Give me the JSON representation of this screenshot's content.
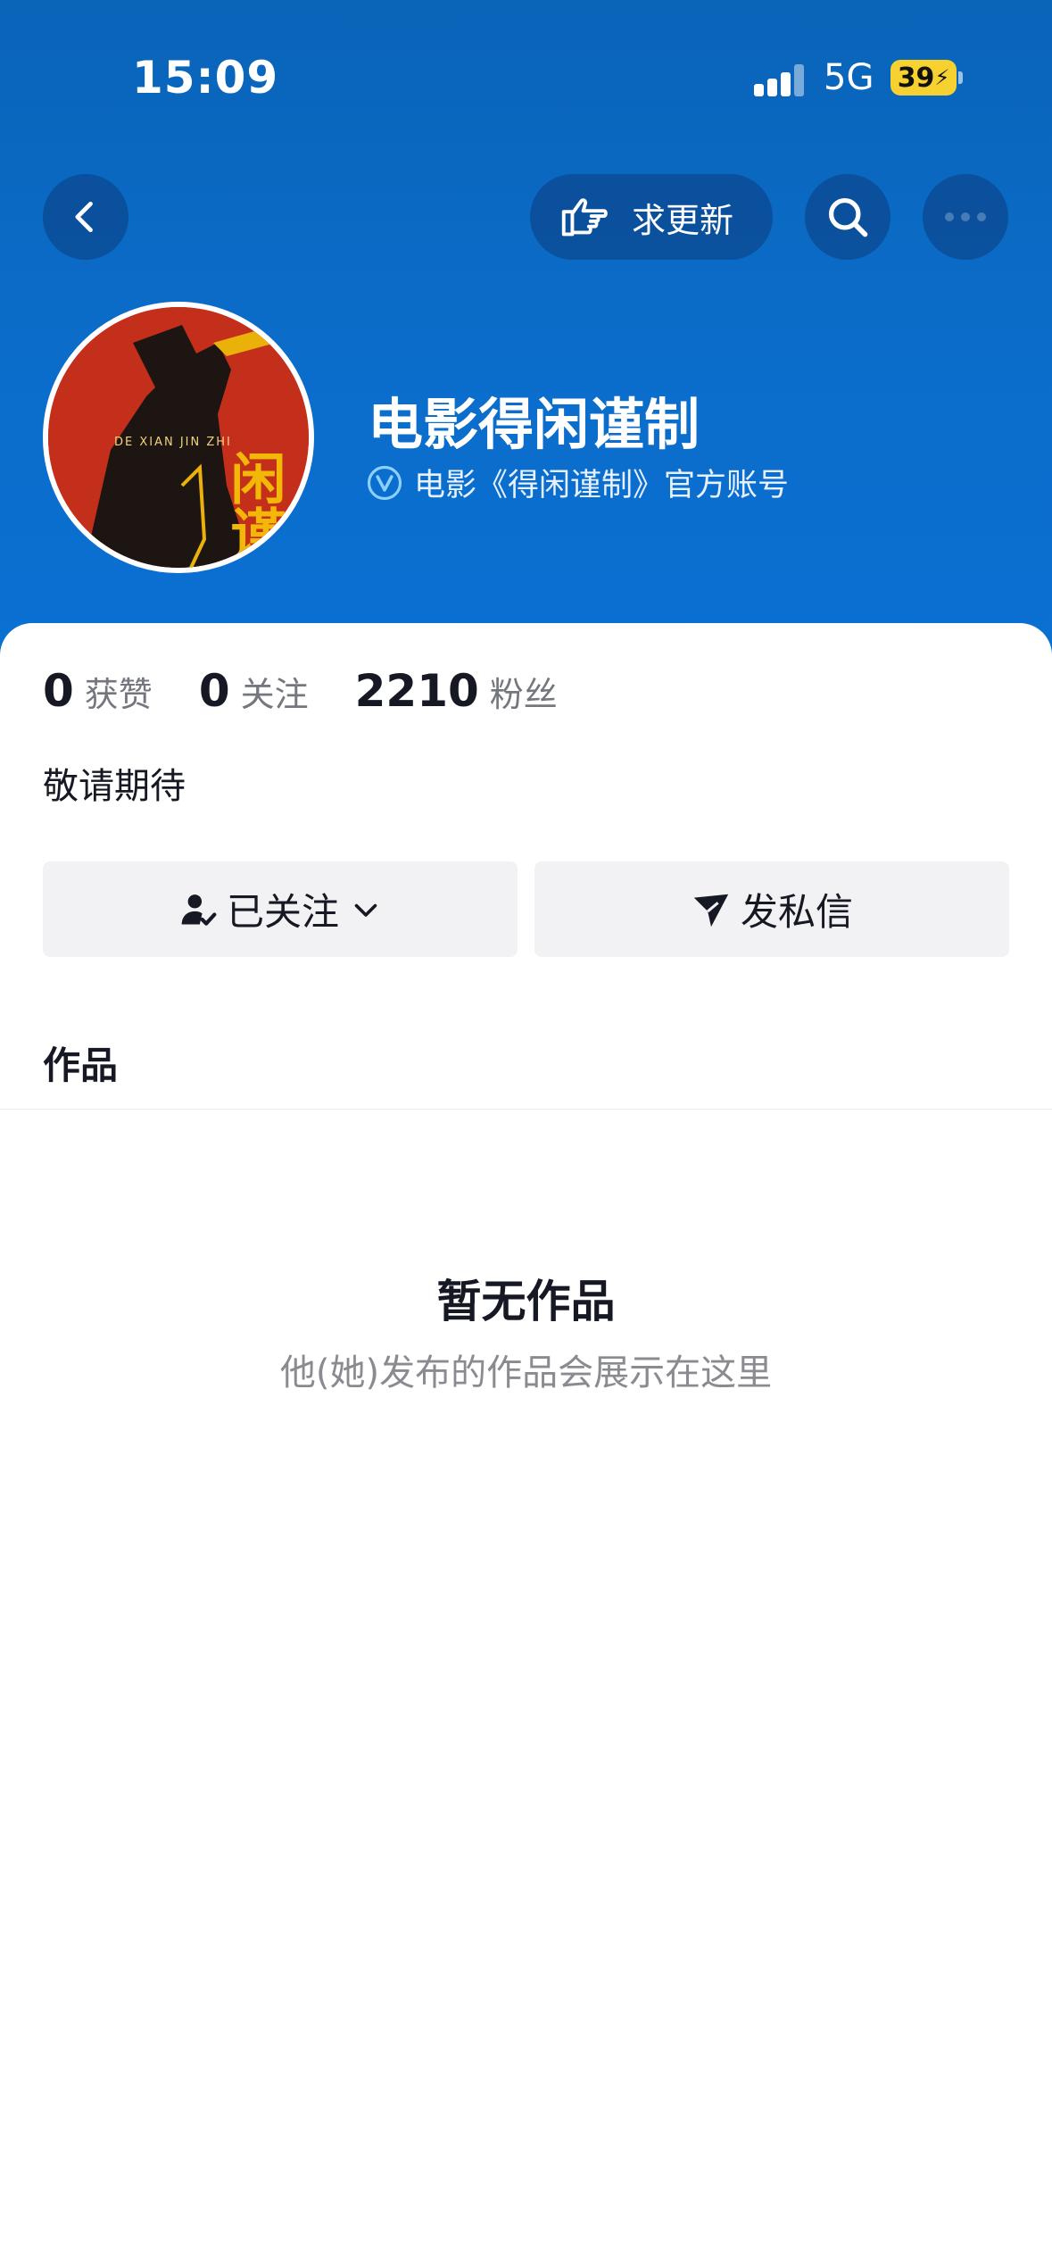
{
  "status_bar": {
    "time": "15:09",
    "network": "5G",
    "battery": "39"
  },
  "nav": {
    "request_update_label": "求更新"
  },
  "profile": {
    "name": "电影得闲谨制",
    "verified_text": "电影《得闲谨制》官方账号",
    "avatar_art_text": "闲谨",
    "avatar_subtext": "DE XIAN JIN ZHI"
  },
  "stats": [
    {
      "value": "0",
      "label": "获赞"
    },
    {
      "value": "0",
      "label": "关注"
    },
    {
      "value": "2210",
      "label": "粉丝"
    }
  ],
  "bio": "敬请期待",
  "actions": {
    "follow_label": "已关注",
    "message_label": "发私信"
  },
  "tabs": {
    "works_label": "作品"
  },
  "empty_state": {
    "title": "暂无作品",
    "subtitle": "他(她)发布的作品会展示在这里"
  },
  "colors": {
    "header_blue": "#0b6dcb",
    "battery_yellow": "#f6d12f",
    "text_dark": "#161823",
    "text_gray": "#8a8b91"
  }
}
